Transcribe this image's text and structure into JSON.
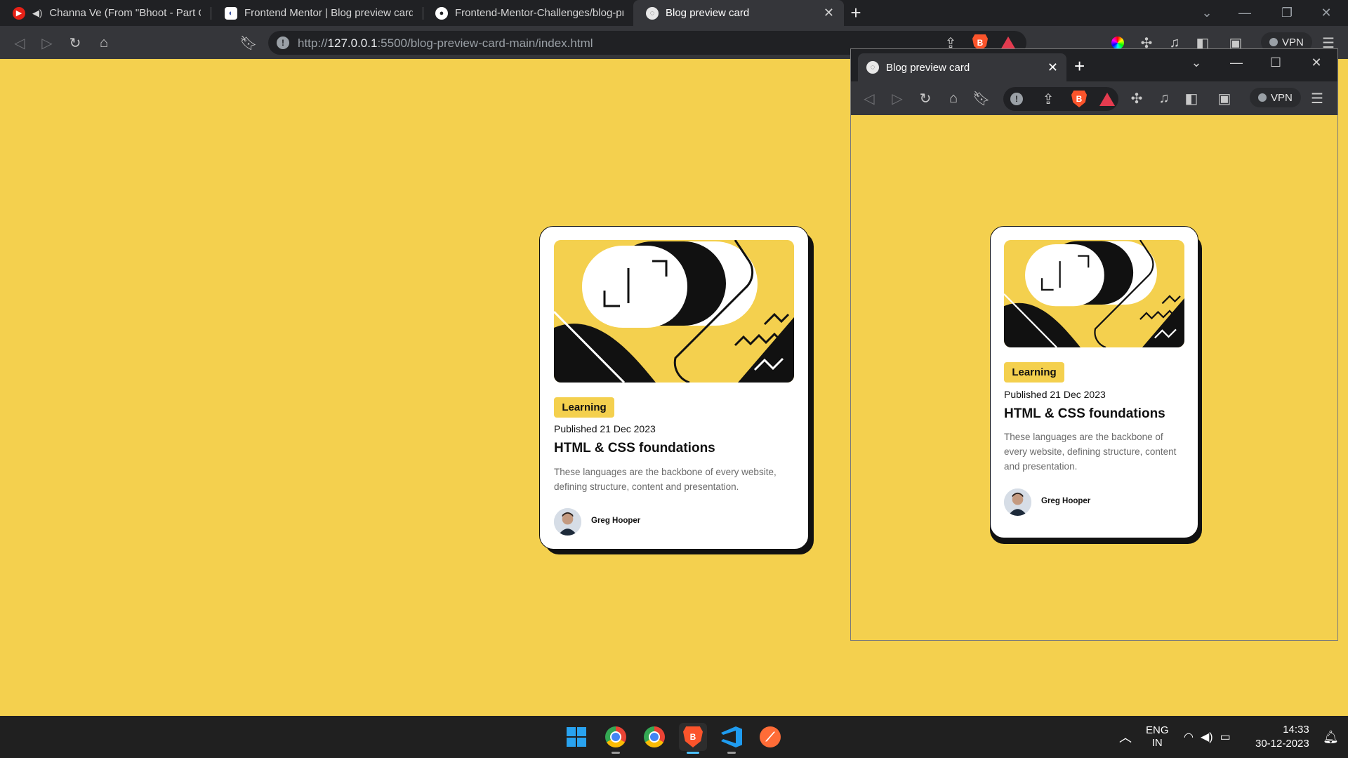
{
  "browser": {
    "tabs": [
      {
        "title": "Channa Ve (From \"Bhoot - Part On",
        "icon": "youtube-icon"
      },
      {
        "title": "Frontend Mentor | Blog preview card",
        "icon": "frontend-mentor-icon"
      },
      {
        "title": "Frontend-Mentor-Challenges/blog-pr",
        "icon": "github-icon"
      },
      {
        "title": "Blog preview card",
        "icon": "globe-icon",
        "active": true
      }
    ],
    "url_prefix": "http://",
    "url_host": "127.0.0.1",
    "url_rest": ":5500/blog-preview-card-main/index.html",
    "vpn_label": "VPN"
  },
  "card": {
    "badge": "Learning",
    "published": "Published 21 Dec 2023",
    "title": "HTML & CSS foundations",
    "description": "These languages are the backbone of every website, defining structure, content and presentation.",
    "author": "Greg Hooper"
  },
  "popup": {
    "tab_title": "Blog preview card",
    "vpn_label": "VPN"
  },
  "taskbar": {
    "apps": [
      "windows-start",
      "chrome",
      "chrome",
      "brave",
      "vscode",
      "postman"
    ],
    "lang_line1": "ENG",
    "lang_line2": "IN",
    "time": "14:33",
    "date": "30-12-2023"
  },
  "colors": {
    "page_bg": "#f4d04e",
    "card_bg": "#ffffff",
    "text_dark": "#111111",
    "text_grey": "#6b6b6b"
  }
}
